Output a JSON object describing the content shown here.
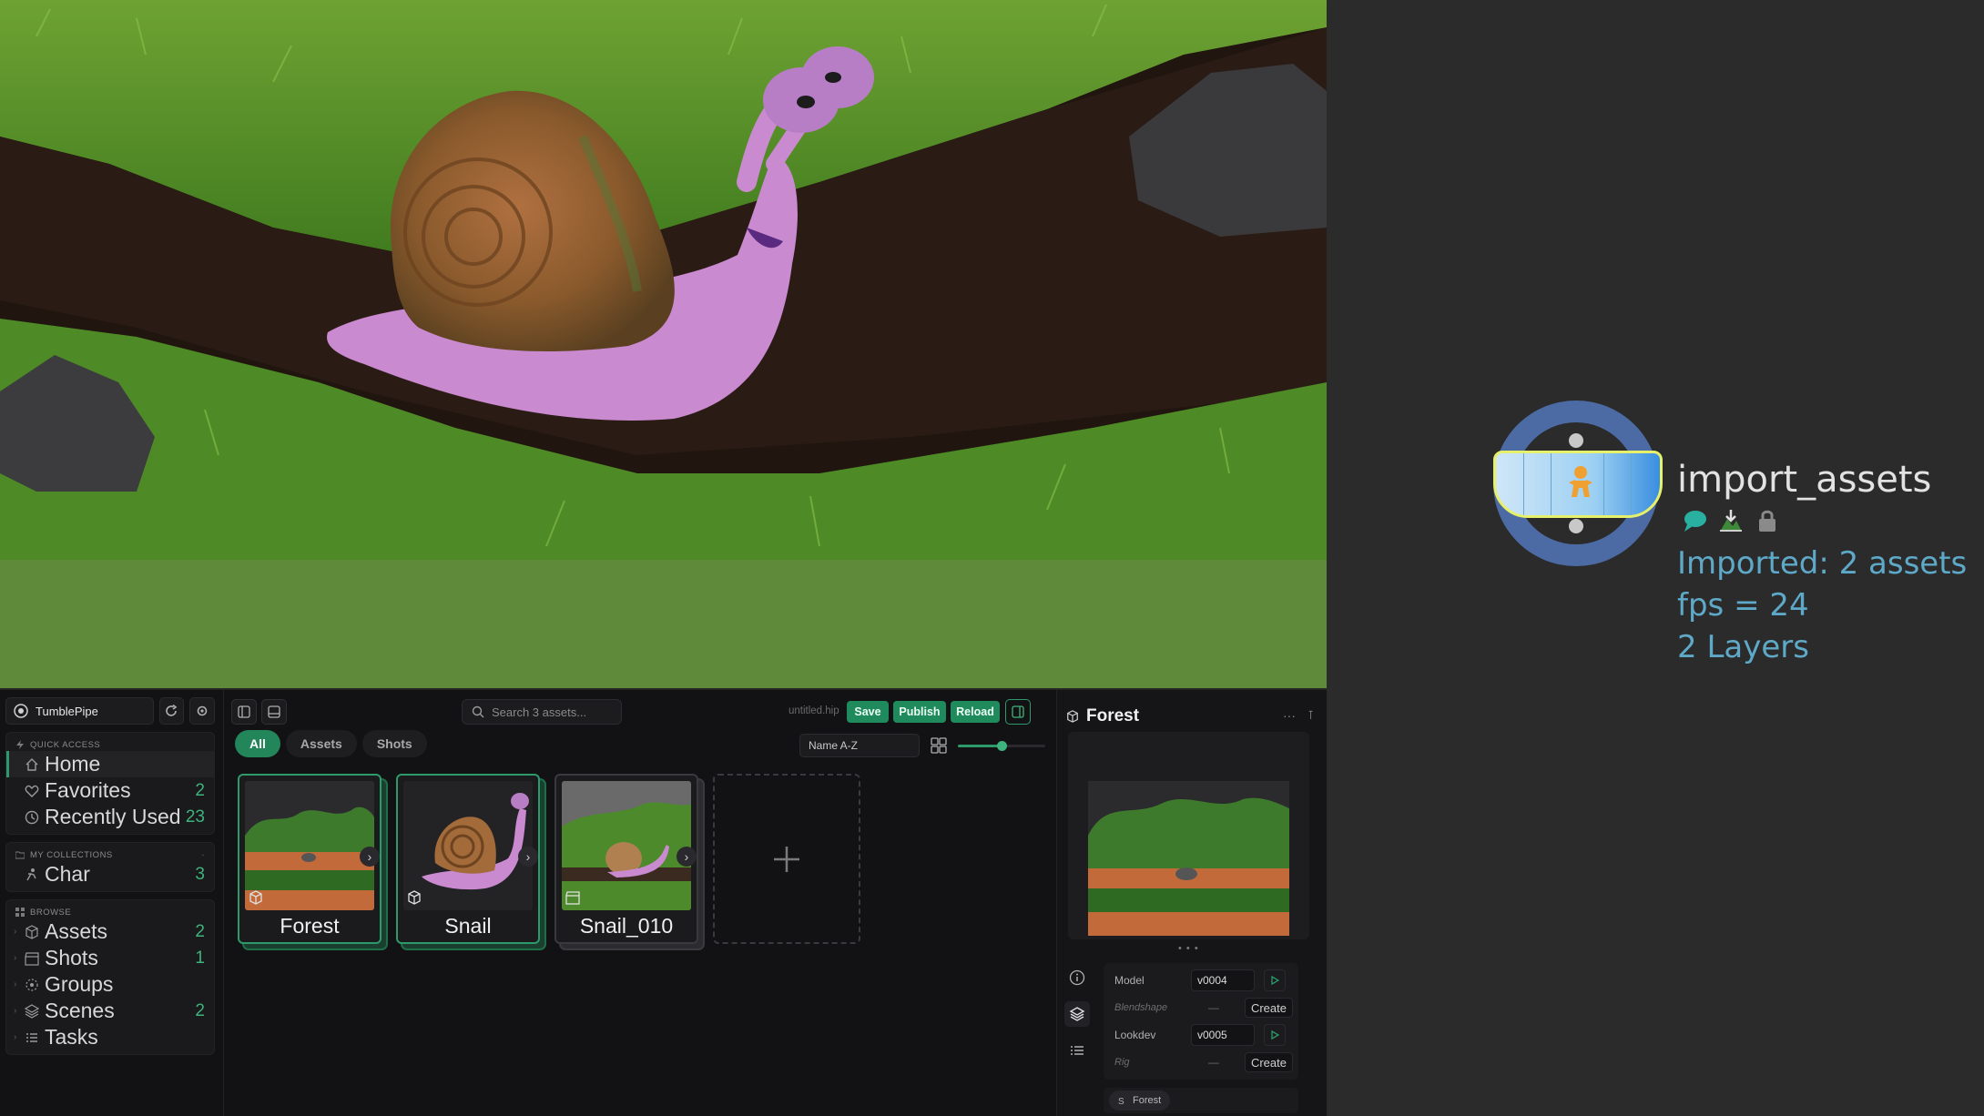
{
  "node": {
    "title": "import_assets",
    "info": [
      "Imported: 2 assets",
      "fps = 24",
      "2 Layers"
    ],
    "badges": [
      "comment-icon",
      "import-icon",
      "lock-icon"
    ]
  },
  "sidebar": {
    "workspace": "TumblePipe",
    "quick_access": {
      "title": "QUICK ACCESS",
      "items": [
        {
          "label": "Home",
          "count": "",
          "icon": "home-icon"
        },
        {
          "label": "Favorites",
          "count": "2",
          "icon": "heart-icon"
        },
        {
          "label": "Recently Used",
          "count": "23",
          "icon": "clock-icon"
        }
      ]
    },
    "collections": {
      "title": "MY COLLECTIONS",
      "items": [
        {
          "label": "Char",
          "count": "3",
          "icon": "person-icon"
        }
      ]
    },
    "browse": {
      "title": "BROWSE",
      "items": [
        {
          "label": "Assets",
          "count": "2",
          "icon": "cube-icon"
        },
        {
          "label": "Shots",
          "count": "1",
          "icon": "clapper-icon"
        },
        {
          "label": "Groups",
          "count": "",
          "icon": "groups-icon"
        },
        {
          "label": "Scenes",
          "count": "2",
          "icon": "layers-icon"
        },
        {
          "label": "Tasks",
          "count": "",
          "icon": "tasks-icon"
        }
      ]
    }
  },
  "toolbar": {
    "search_placeholder": "Search 3 assets...",
    "filename": "untitled.hip",
    "save": "Save",
    "publish": "Publish",
    "reload": "Reload"
  },
  "tabs": [
    "All",
    "Assets",
    "Shots"
  ],
  "sort": "Name A-Z",
  "zoom_level": 0.5,
  "cards": [
    {
      "name": "Forest",
      "type": "asset"
    },
    {
      "name": "Snail",
      "type": "asset"
    },
    {
      "name": "Snail_010",
      "type": "shot"
    }
  ],
  "details": {
    "title": "Forest",
    "layers": [
      {
        "name": "Model",
        "version": "v0004",
        "state": "published"
      },
      {
        "name": "Blendshape",
        "version": "—",
        "state": "create",
        "action": "Create"
      },
      {
        "name": "Lookdev",
        "version": "v0005",
        "state": "published"
      },
      {
        "name": "Rig",
        "version": "—",
        "state": "create",
        "action": "Create"
      }
    ],
    "scene_chip": "Forest"
  },
  "colors": {
    "accent": "#2e9a6c",
    "node_ring": "#4c6ba4",
    "node_info": "#5fa9c8"
  }
}
